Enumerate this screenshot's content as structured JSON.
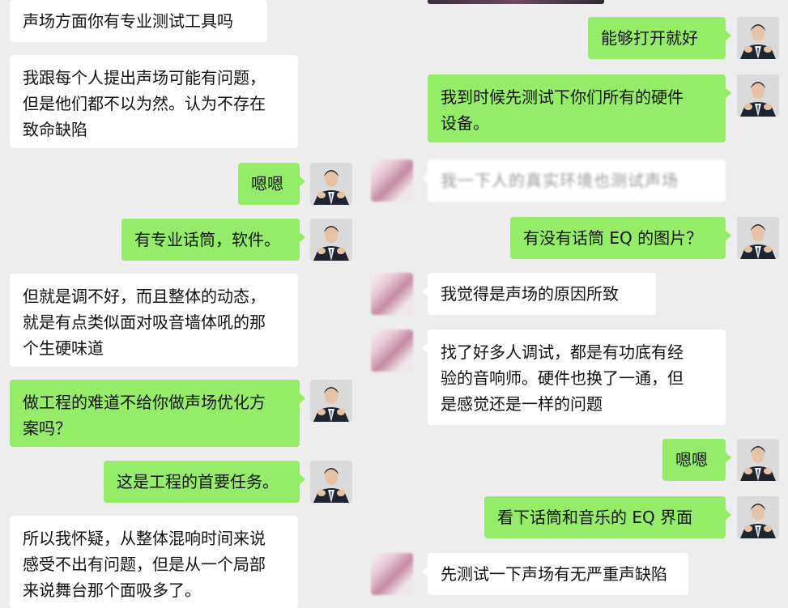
{
  "left_column": [
    {
      "text": "声场方面你有专业测试工具吗"
    },
    {
      "text": "我跟每个人提出声场可能有问题，\n但是他们都不以为然。认为不存在\n致命缺陷"
    },
    {
      "text": "嗯嗯"
    },
    {
      "text": "有专业话筒，软件。"
    },
    {
      "text": "但就是调不好，而且整体的动态，\n就是有点类似面对吸音墙体吼的那\n个生硬味道"
    },
    {
      "text": "做工程的难道不给你做声场优化方\n案吗？"
    },
    {
      "text": "这是工程的首要任务。"
    },
    {
      "text": "所以我怀疑，从整体混响时间来说\n感受不出有问题，但是从一个局部\n来说舞台那个面吸多了。"
    }
  ],
  "right_column": [
    {
      "text": "能够打开就好"
    },
    {
      "text": "我到时候先测试下你们所有的硬件\n设备。"
    },
    {
      "text": "我一下人的真实环境也测试声场"
    },
    {
      "text": "有没有话筒 EQ 的图片？"
    },
    {
      "text": "我觉得是声场的原因所致"
    },
    {
      "text": "找了好多人调试，都是有功底有经\n验的音响师。硬件也换了一通，但\n是感觉还是一样的问题"
    },
    {
      "text": "嗯嗯"
    },
    {
      "text": "看下话筒和音乐的 EQ 界面"
    },
    {
      "text": "先测试一下声场有无严重声缺陷"
    }
  ],
  "avatars": {
    "self": "person-in-suit-avatar",
    "other": "blurred-avatar"
  },
  "colors": {
    "background": "#ededed",
    "incoming_bubble": "#ffffff",
    "outgoing_bubble": "#95ec69"
  }
}
